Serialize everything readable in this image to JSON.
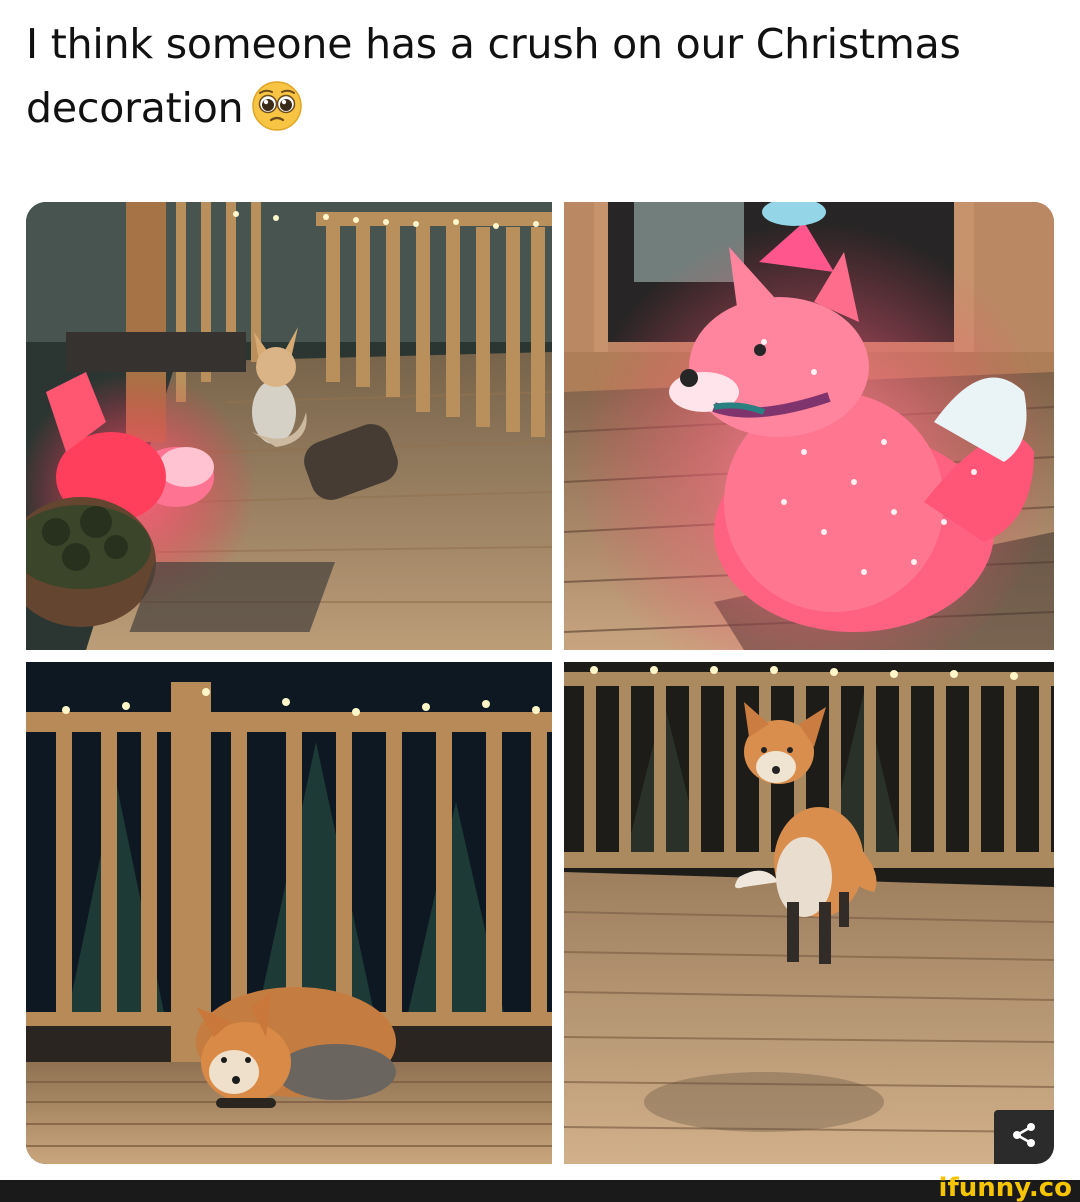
{
  "post": {
    "caption": "I think someone has a crush on our Christmas decoration",
    "emoji": "pleading-face-emoji"
  },
  "collage": {
    "panels": [
      {
        "subject": "fox-near-glowing-decoration"
      },
      {
        "subject": "glowing-fox-decoration"
      },
      {
        "subject": "fox-curled-on-deck"
      },
      {
        "subject": "fox-standing-on-deck"
      }
    ]
  },
  "share": {
    "icon": "share-icon"
  },
  "watermark": {
    "text": "ifunny.co"
  },
  "colors": {
    "glow_pink": "#ff5a7a",
    "fox_orange": "#d98a46",
    "deck_wood": "#c9a57c"
  }
}
